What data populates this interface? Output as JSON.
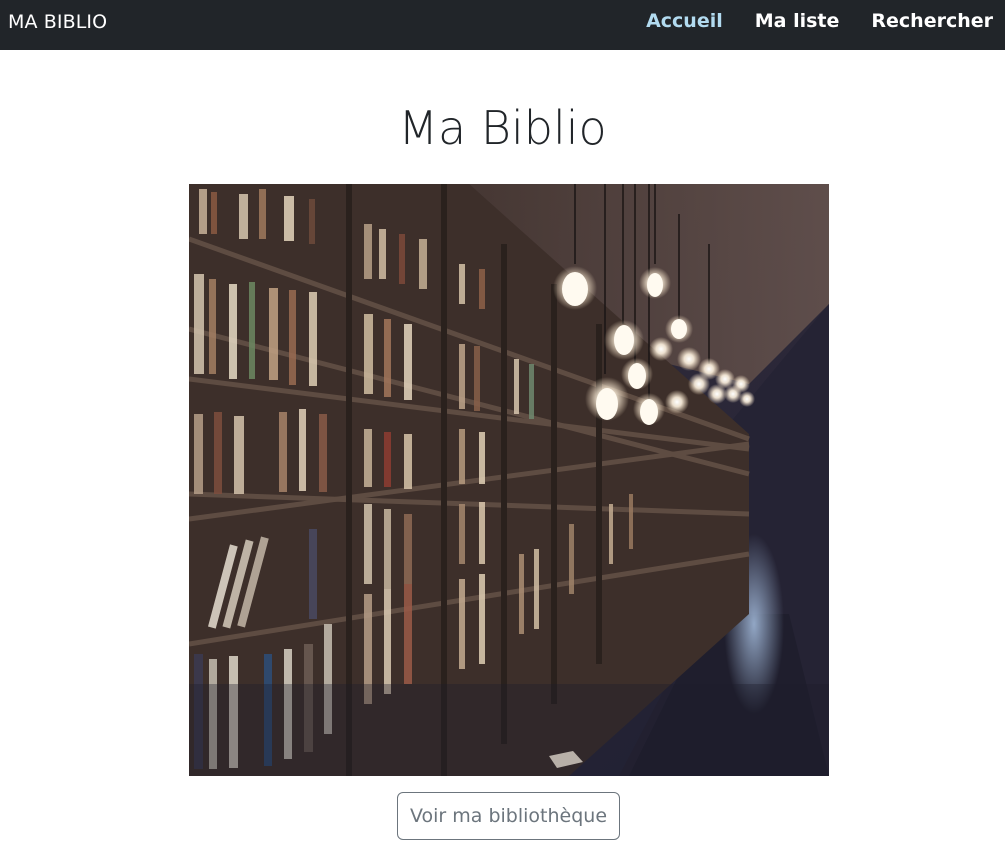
{
  "navbar": {
    "brand": "MA BIBLIO",
    "links": [
      {
        "label": "Accueil",
        "active": true
      },
      {
        "label": "Ma liste",
        "active": false
      },
      {
        "label": "Rechercher",
        "active": false
      }
    ]
  },
  "main": {
    "title": "Ma Biblio",
    "hero_image": {
      "subject": "library bookshelves with hanging light bulbs"
    },
    "cta_label": "Voir ma bibliothèque"
  },
  "colors": {
    "navbar_bg": "#212529",
    "active_link": "#b2dbf0",
    "button_border": "#6c757d"
  }
}
